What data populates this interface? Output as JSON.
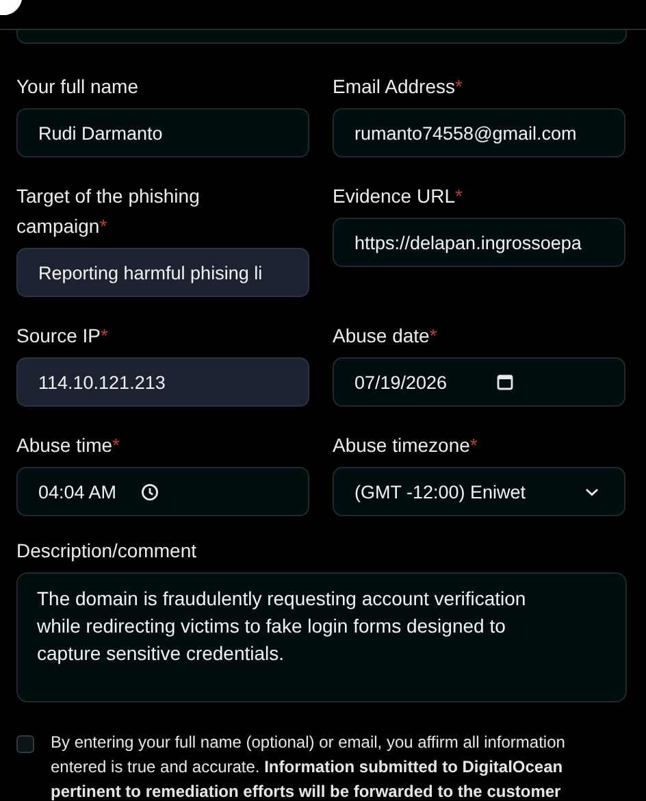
{
  "fields": [
    {
      "label": "Your full name",
      "value": "Rudi Darmanto",
      "kind": "text",
      "autofilled": false
    },
    {
      "label": "Email Address",
      "required_mark": "*",
      "value": "rumanto74558@gmail.com",
      "kind": "text",
      "autofilled": false
    },
    {
      "label": "Target of the phishing campaign",
      "required_mark": "*",
      "value": "Reporting harmful phising li",
      "kind": "text",
      "autofilled": true
    },
    {
      "label": "Evidence URL",
      "required_mark": "*",
      "value": "https://delapan.ingrossoepa",
      "kind": "text",
      "autofilled": false
    },
    {
      "label": "Source IP",
      "required_mark": "*",
      "value": "114.10.121.213",
      "kind": "text",
      "autofilled": true
    },
    {
      "label": "Abuse date",
      "required_mark": "*",
      "value": "07/19/2026",
      "kind": "date",
      "autofilled": false
    },
    {
      "label": "Abuse time",
      "required_mark": "*",
      "value": "04:04  AM",
      "kind": "time",
      "autofilled": false
    },
    {
      "label": "Abuse timezone",
      "required_mark": "*",
      "value": "(GMT -12:00) Eniwet",
      "kind": "select",
      "autofilled": false
    }
  ],
  "description": {
    "label": "Description/comment",
    "value": "The domain is fraudulently requesting account verification while redirecting victims to fake login forms designed to capture sensitive credentials."
  },
  "consent": {
    "checked": false,
    "text": "By entering your full name (optional) or email, you affirm all information entered is true and accurate. **Information submitted to DigitalOcean pertinent to remediation efforts will be forwarded to the customer**"
  }
}
